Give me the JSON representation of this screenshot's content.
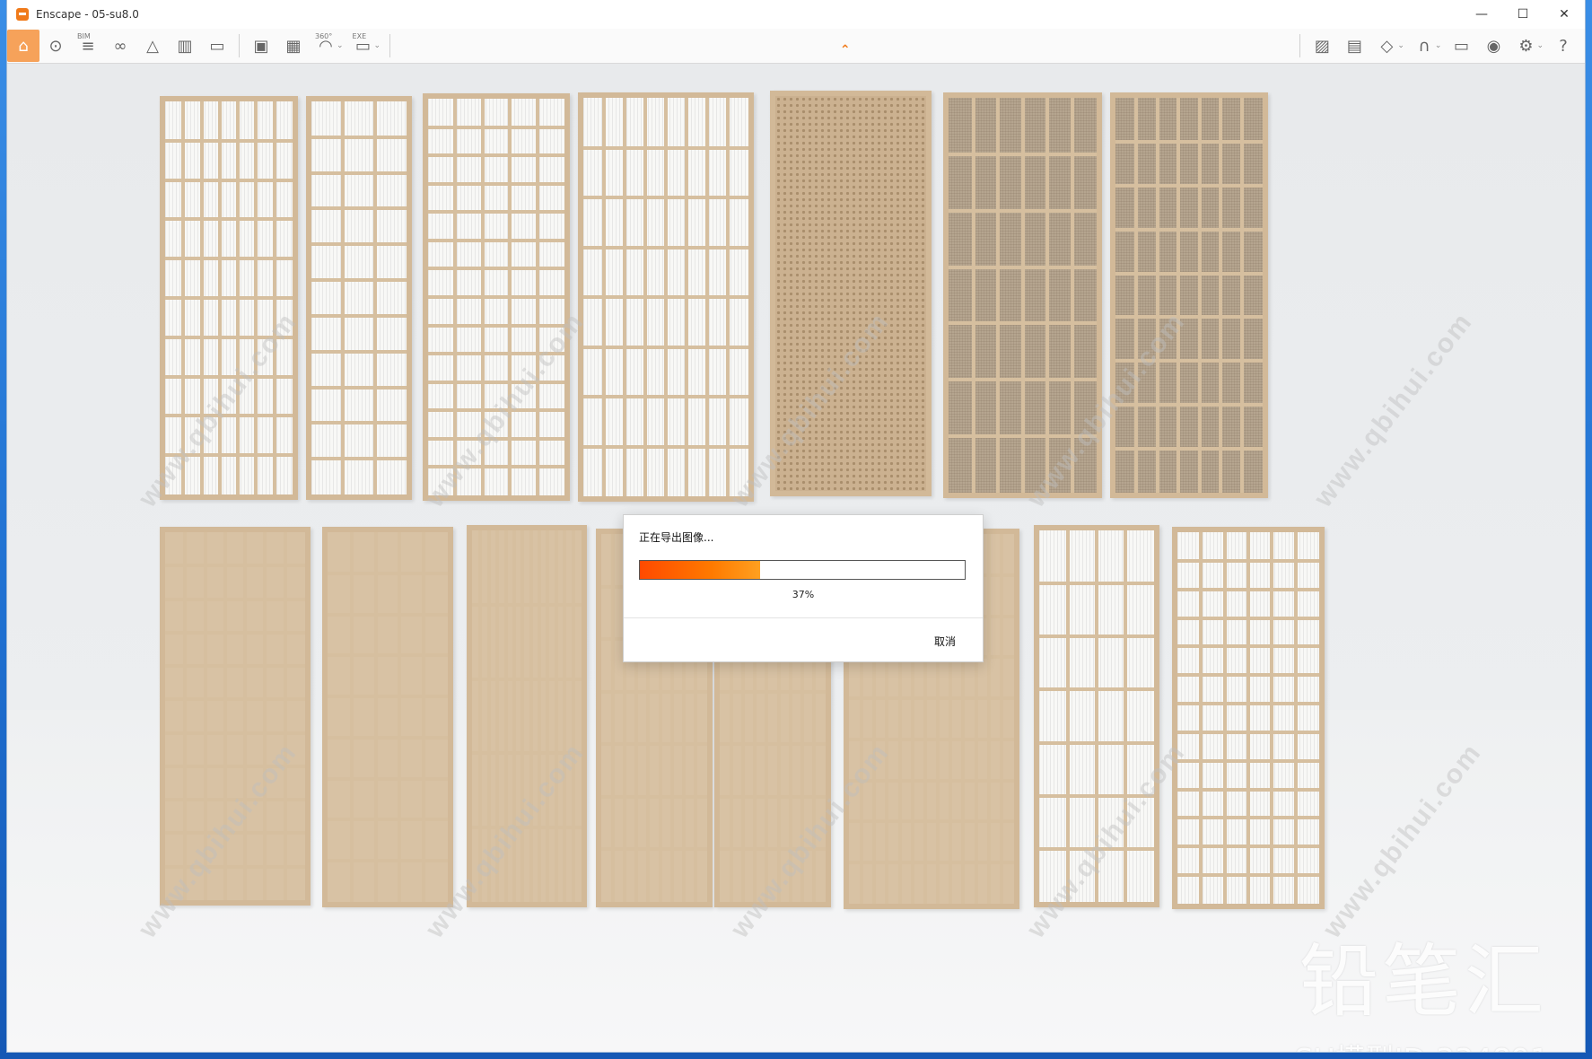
{
  "window": {
    "title": "Enscape - 05-su8.0",
    "controls": {
      "minimize": "—",
      "maximize": "☐",
      "close": "✕"
    }
  },
  "toolbar": {
    "left": [
      {
        "name": "home-icon",
        "glyph": "⌂",
        "active": true
      },
      {
        "name": "location-pin-icon",
        "glyph": "⊙"
      },
      {
        "name": "bim-icon",
        "glyph": "≡",
        "small": "BIM"
      },
      {
        "name": "binoculars-icon",
        "glyph": "∞"
      },
      {
        "name": "atmosphere-icon",
        "glyph": "△"
      },
      {
        "name": "buildings-icon",
        "glyph": "▥"
      },
      {
        "name": "video-clapper-icon",
        "glyph": "▭"
      }
    ],
    "export": [
      {
        "name": "screenshot-export-icon",
        "glyph": "▣"
      },
      {
        "name": "batch-export-icon",
        "glyph": "▦"
      },
      {
        "name": "panorama-360-icon",
        "glyph": "◠",
        "small": "360°",
        "dropdown": true
      },
      {
        "name": "exe-export-icon",
        "glyph": "▭",
        "small": "EXE",
        "dropdown": true
      }
    ],
    "right": [
      {
        "name": "map-icon",
        "glyph": "▨"
      },
      {
        "name": "asset-library-icon",
        "glyph": "▤"
      },
      {
        "name": "cube-view-icon",
        "glyph": "◇",
        "dropdown": true
      },
      {
        "name": "material-editor-icon",
        "glyph": "∩",
        "dropdown": true
      },
      {
        "name": "vr-headset-icon",
        "glyph": "▭"
      },
      {
        "name": "eye-view-icon",
        "glyph": "◉"
      },
      {
        "name": "settings-gear-icon",
        "glyph": "⚙",
        "dropdown": true
      },
      {
        "name": "help-icon",
        "glyph": "?"
      }
    ],
    "collapse_glyph": "⌃"
  },
  "dialog": {
    "title": "正在导出图像...",
    "progress": 0.37,
    "progress_label": "37%",
    "cancel_label": "取消"
  },
  "watermark": {
    "brand": "铅笔汇",
    "model_id": "SU模型ID:334891",
    "url": "www.qbihui.com"
  },
  "colors": {
    "accent": "#f07a1a",
    "progress_start": "#ff4a00",
    "progress_end": "#ffa020",
    "wood": "#d2b998"
  }
}
